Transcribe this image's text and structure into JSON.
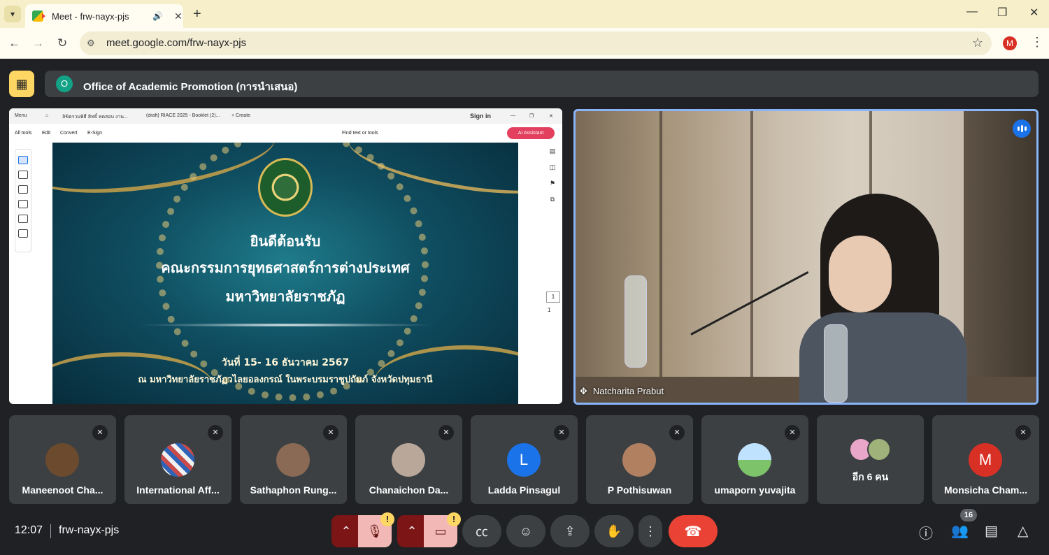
{
  "browser": {
    "tab_title": "Meet - frw-nayx-pjs",
    "url": "meet.google.com/frw-nayx-pjs",
    "profile_initial": "M"
  },
  "meeting": {
    "presenter_title": "Office of Academic Promotion (การนำเสนอ)",
    "presenter_initial": "O",
    "time": "12:07",
    "code": "frw-nayx-pjs"
  },
  "shared_screen": {
    "app_tabs": [
      "Menu",
      "ลิขิตรวมพิธี สิทธิ์ ทดสอบ งาน...",
      "(draft) RIACE 2025 - Booklet (2)...",
      "+ Create",
      "Sign in"
    ],
    "tools": [
      "All tools",
      "Edit",
      "Convert",
      "E-Sign"
    ],
    "find_text": "Find text or tools",
    "ai_assistant": "AI Assistant",
    "page_current": "1",
    "page_total": "1",
    "slide": {
      "line1": "ยินดีต้อนรับ",
      "line2": "คณะกรรมการยุทธศาสตร์การต่างประเทศ",
      "line3": "มหาวิทยาลัยราชภัฏ",
      "date": "วันที่ 15- 16 ธันวาคม 2567",
      "venue": "ณ มหาวิทยาลัยราชภัฏวไลยอลงกรณ์ ในพระบรมราชูปถัมภ์ จังหวัดปทุมธานี"
    }
  },
  "speaker": {
    "name": "Natcharita Prabut"
  },
  "participants": [
    {
      "name": "Maneenoot Cha...",
      "initial": "",
      "color": "#6b4a2e"
    },
    {
      "name": "International Aff...",
      "initial": "",
      "color": "#c94b4b"
    },
    {
      "name": "Sathaphon Rung...",
      "initial": "",
      "color": "#8a6a55"
    },
    {
      "name": "Chanaichon Da...",
      "initial": "",
      "color": "#b9a79a"
    },
    {
      "name": "Ladda Pinsagul",
      "initial": "L",
      "color": "#1a73e8"
    },
    {
      "name": "P Pothisuwan",
      "initial": "",
      "color": "#b08060"
    },
    {
      "name": "umaporn yuvajita",
      "initial": "",
      "color": "#7cc36a"
    },
    {
      "name": "อีก 6 คน",
      "initial": "",
      "color": "#3c4043"
    },
    {
      "name": "Monsicha Cham...",
      "initial": "M",
      "color": "#d93025"
    }
  ],
  "people_count": "16",
  "colors": {
    "accent": "#8ab4f8",
    "end_call": "#ea4335",
    "warning": "#fdd663"
  }
}
